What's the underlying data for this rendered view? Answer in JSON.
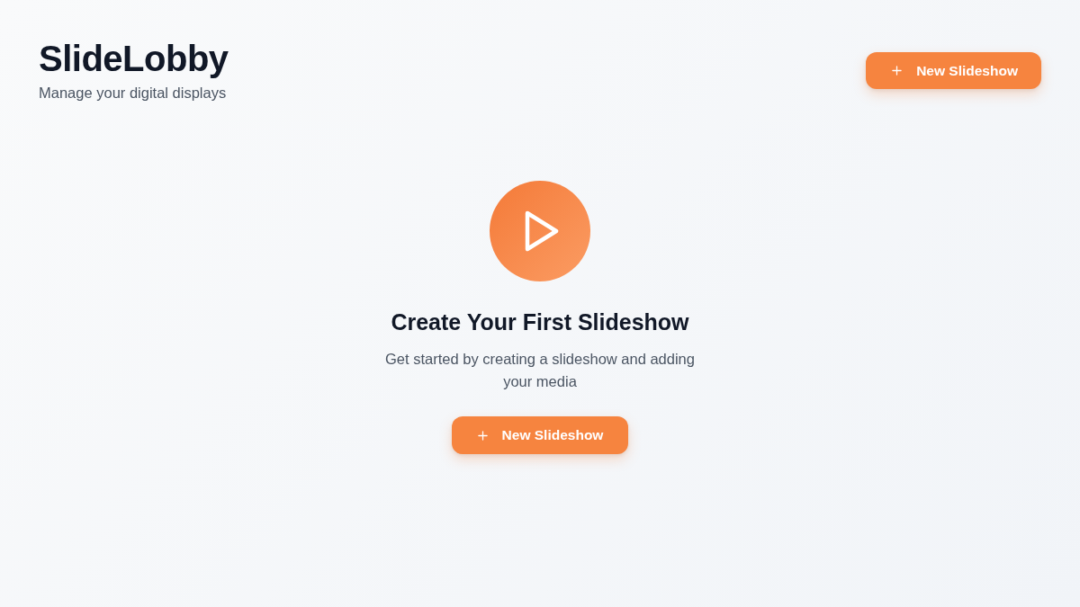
{
  "header": {
    "title": "SlideLobby",
    "subtitle": "Manage your digital displays",
    "button": "New Slideshow"
  },
  "empty_state": {
    "heading": "Create Your First Slideshow",
    "text": "Get started by creating a slideshow and adding your media",
    "button": "New Slideshow"
  }
}
